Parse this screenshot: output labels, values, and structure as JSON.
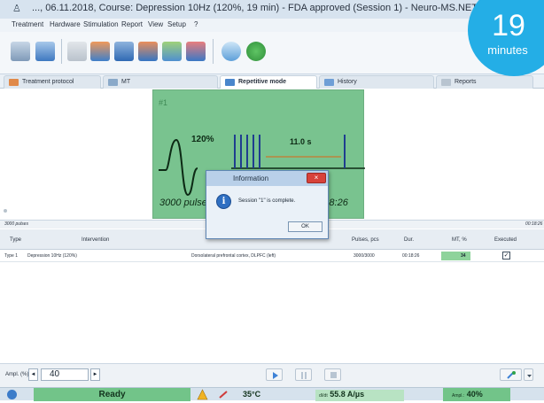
{
  "window": {
    "title": "..., 06.11.2018, Course: Depression 10Hz (120%, 19 min) - FDA approved (Session 1) - Neuro-MS.NET"
  },
  "menu": [
    "Treatment",
    "Hardware",
    "Stimulation",
    "Report",
    "View",
    "Setup",
    "?"
  ],
  "badge": {
    "number": "19",
    "unit": "minutes"
  },
  "tabs": [
    {
      "label": "Treatment protocol"
    },
    {
      "label": "MT"
    },
    {
      "label": "Repetitive mode"
    },
    {
      "label": "History"
    },
    {
      "label": "Reports"
    }
  ],
  "stim_panel": {
    "number": "#1",
    "percent": "120%",
    "duration": "11.0 s",
    "pulses": "3000 pulse",
    "time": "00:18:26"
  },
  "dialog": {
    "title": "Information",
    "close": "×",
    "message": "Session \"1\" is complete.",
    "ok": "OK"
  },
  "table": {
    "pulses_total": "3000 pulses",
    "elapsed": "00:18:26",
    "columns": {
      "type": "Type",
      "intervention": "Intervention",
      "pulses": "Pulses, pcs",
      "dur": "Dur.",
      "mt": "MT, %",
      "executed": "Executed"
    },
    "rows": [
      {
        "type": "Type 1",
        "intervention": "Depression 10Hz (120%)",
        "target": "Dorsolateral prefrontal cortex, DLPFC (left)",
        "pulses": "3000/3000",
        "dur": "00:18:26",
        "mt": "34",
        "executed": "✓"
      }
    ]
  },
  "controls": {
    "ampl_label": "Ampl. (%):",
    "ampl_value": "40",
    "dec": "◄",
    "inc": "►"
  },
  "status": {
    "ready": "Ready",
    "temperature": "35°C",
    "rate_prefix": "dI/dt",
    "rate": "55.8 A/µs",
    "ampl_prefix": "Ampl.:",
    "ampl": "40%"
  },
  "colors": {
    "accent": "#24aee6",
    "stim_panel": "#79c38f",
    "status_green": "#72c489",
    "dialog_close": "#d7423a"
  }
}
